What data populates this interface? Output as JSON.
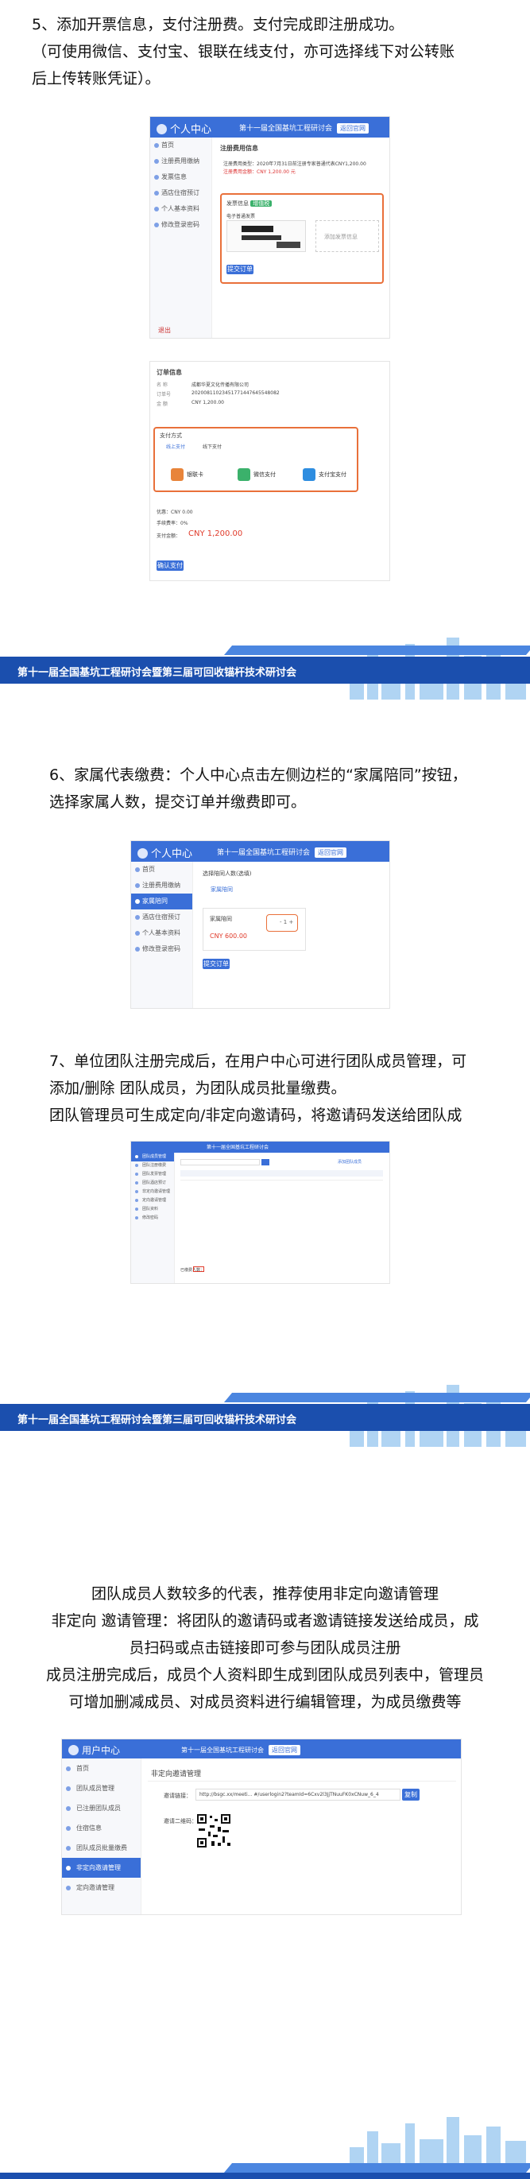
{
  "step5": {
    "line1": "5、添加开票信息，支付注册费。支付完成即注册成功。",
    "line2": "（可使用微信、支付宝、银联在线支付，亦可选择线下对公转账",
    "line3": "后上传转账凭证）。"
  },
  "step6": {
    "line1": "6、家属代表缴费：个人中心点击左侧边栏的“家属陪同”按钮，",
    "line2": "选择家属人数，提交订单并缴费即可。"
  },
  "step7": {
    "line1": "7、单位团队注册完成后，在用户中心可进行团队成员管理，可",
    "line2": "添加/删除 团队成员，为团队成员批量缴费。",
    "line3": "团队管理员可生成定向/非定向邀请码，将邀请码发送给团队成"
  },
  "invite": {
    "line1": "团队成员人数较多的代表，推荐使用非定向邀请管理",
    "line2": "非定向 邀请管理：将团队的邀请码或者邀请链接发送给成员，成",
    "line3": "员扫码或点击链接即可参与团队成员注册",
    "line4": "成员注册完成后，成员个人资料即生成到团队成员列表中，管理员",
    "line5": "可增加删减成员、对成员资料进行编辑管理，为成员缴费等"
  },
  "banner": {
    "title": "第十一届全国基坑工程研讨会暨第三届可回收锚杆技术研讨会"
  },
  "ui1": {
    "brand": "个人中心",
    "project": "第十一届全国基坑工程研讨会",
    "project_btn": "返回官网",
    "menu": [
      "首页",
      "注册费用缴纳",
      "发票信息",
      "酒店住宿预订",
      "个人基本资料",
      "修改登录密码"
    ],
    "section_title": "注册费用信息",
    "fee_line1": "注册费用类型：2020年7月31日前注册专家普通代表CNY1,200.00",
    "fee_line2": "注册费用金额：CNY 1,200.00 元",
    "invoice_label": "发票信息",
    "invoice_tag": "增值税",
    "invoice_head": "电子普通发票",
    "add_invoice": "添加发票信息",
    "submit": "提交订单",
    "logout": "退出"
  },
  "ui2": {
    "order_title": "订单信息",
    "company": "成都华夏文化传播有限公司",
    "order_no": "20200811023451771447645548082",
    "amount": "CNY 1,200.00",
    "pay_title": "支付方式",
    "pay_online": "线上支付",
    "pay_offline": "线下支付",
    "methods": [
      "银联卡",
      "微信支付",
      "支付宝支付"
    ],
    "discount_label": "优惠：CNY 0.00",
    "rate_label": "手续费率：0%",
    "total_label": "支付金额：",
    "total": "CNY 1,200.00",
    "pay_btn": "确认支付"
  },
  "ui3": {
    "brand": "个人中心",
    "project": "第十一届全国基坑工程研讨会",
    "project_btn": "返回官网",
    "menu": [
      "首页",
      "注册费用缴纳",
      "家属陪同",
      "酒店住宿预订",
      "个人基本资料",
      "修改登录密码"
    ],
    "title": "选择陪同人数(选填)",
    "section": "家属陪同",
    "item": "家属陪同",
    "price": "CNY 600.00",
    "qty": "1",
    "submit": "提交订单"
  },
  "ui4": {
    "project": "第十一届全国基坑工程研讨会",
    "menu": [
      "团队成员管理",
      "团队注册缴费",
      "团队发票管理",
      "团队酒店预订",
      "非定向邀请管理",
      "定向邀请管理",
      "团队资料",
      "修改密码"
    ],
    "add_btn": "添加团队成员",
    "paid_label": "已缴费人数："
  },
  "ui5": {
    "brand": "用户中心",
    "project": "第十一届全国基坑工程研讨会",
    "project_btn": "返回官网",
    "menu": [
      "首页",
      "团队成员管理",
      "已注册团队成员",
      "住宿信息",
      "团队成员批量缴费",
      "非定向邀请管理",
      "定向邀请管理"
    ],
    "title": "非定向邀请管理",
    "link_label": "邀请链接：",
    "link_value": "http://bsgc.xx/meeti...  #/userlogin2?teamId=6Cxv2l3JjTNuuFK0xCNuw_6_4",
    "copy_btn": "复制",
    "qr_label": "邀请二维码："
  }
}
